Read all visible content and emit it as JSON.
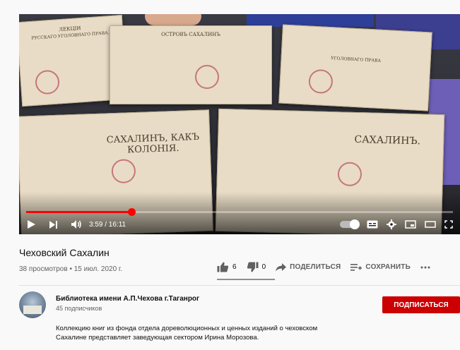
{
  "video": {
    "time_current": "3:59",
    "time_total": "16:11",
    "time_display": "3:59 / 16:11",
    "progress_fraction": 0.246,
    "book_titles": [
      "САХАЛИНЪ, КАКЪ КОЛОНIЯ.",
      "САХАЛИНЪ."
    ]
  },
  "meta": {
    "title": "Чеховский Сахалин",
    "stats": "38 просмотров • 15 июл. 2020 г.",
    "likes": "6",
    "dislikes": "0",
    "like_fraction": 1.0,
    "share_label": "ПОДЕЛИТЬСЯ",
    "save_label": "СОХРАНИТЬ"
  },
  "channel": {
    "name": "Библиотека имени А.П.Чехова г.Таганрог",
    "subscribers": "45 подписчиков",
    "subscribe_label": "ПОДПИСАТЬСЯ"
  },
  "description": {
    "line1": "Коллекцию книг из фонда отдела дореволюционных и ценных изданий о чеховском",
    "line2": "Сахалине представляет заведующая сектором Ирина Морозова."
  },
  "colors": {
    "accent": "#ff0000",
    "subscribe": "#cc0000"
  }
}
